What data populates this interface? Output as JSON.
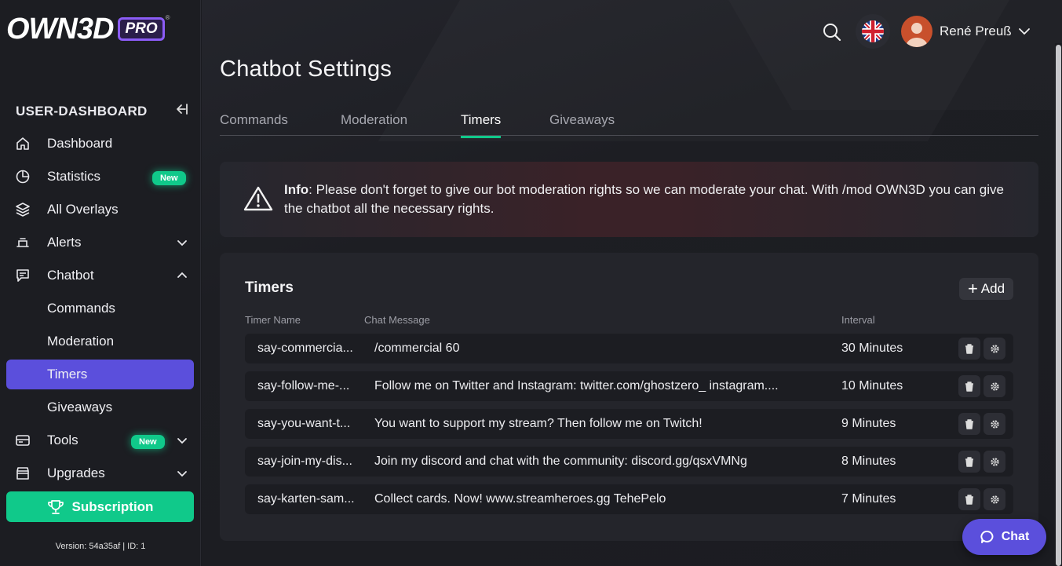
{
  "brand": {
    "logo_text": "OWN3D",
    "logo_badge": "PRO",
    "logo_reg": "®"
  },
  "sidebar": {
    "heading": "USER-DASHBOARD",
    "items": [
      {
        "label": "Dashboard"
      },
      {
        "label": "Statistics",
        "badge": "New"
      },
      {
        "label": "All Overlays"
      },
      {
        "label": "Alerts"
      },
      {
        "label": "Chatbot"
      },
      {
        "label": "Commands"
      },
      {
        "label": "Moderation"
      },
      {
        "label": "Timers"
      },
      {
        "label": "Giveaways"
      },
      {
        "label": "Tools",
        "badge": "New"
      },
      {
        "label": "Upgrades"
      }
    ],
    "subscription_label": "Subscription",
    "version": "Version: 54a35af | ID: 1"
  },
  "topbar": {
    "user_name": "René Preuß",
    "language_icon": "uk-flag-icon"
  },
  "page": {
    "title": "Chatbot Settings",
    "tabs": [
      {
        "label": "Commands"
      },
      {
        "label": "Moderation"
      },
      {
        "label": "Timers",
        "active": true
      },
      {
        "label": "Giveaways"
      }
    ]
  },
  "info": {
    "prefix": "Info",
    "text": ": Please don't forget to give our bot moderation rights so we can moderate your chat. With /mod OWN3D you can give the chatbot all the necessary rights."
  },
  "timers": {
    "title": "Timers",
    "add_label": "Add",
    "headers": {
      "name": "Timer Name",
      "message": "Chat Message",
      "interval": "Interval"
    },
    "rows": [
      {
        "name": "say-commercia...",
        "message": "/commercial 60",
        "interval": "30 Minutes"
      },
      {
        "name": "say-follow-me-...",
        "message": "Follow me on Twitter and Instagram: twitter.com/ghostzero_ instagram....",
        "interval": "10 Minutes"
      },
      {
        "name": "say-you-want-t...",
        "message": "You want to support my stream? Then follow me on Twitch!",
        "interval": "9 Minutes"
      },
      {
        "name": "say-join-my-dis...",
        "message": "Join my discord and chat with the community: discord.gg/qsxVMNg",
        "interval": "8 Minutes"
      },
      {
        "name": "say-karten-sam...",
        "message": "Collect cards. Now! www.streamheroes.gg TehePelo",
        "interval": "7 Minutes"
      }
    ]
  },
  "chat_widget": {
    "label": "Chat"
  },
  "colors": {
    "accent_purple": "#5b4fdc",
    "accent_green": "#10c98a",
    "background": "#1a1b20"
  }
}
